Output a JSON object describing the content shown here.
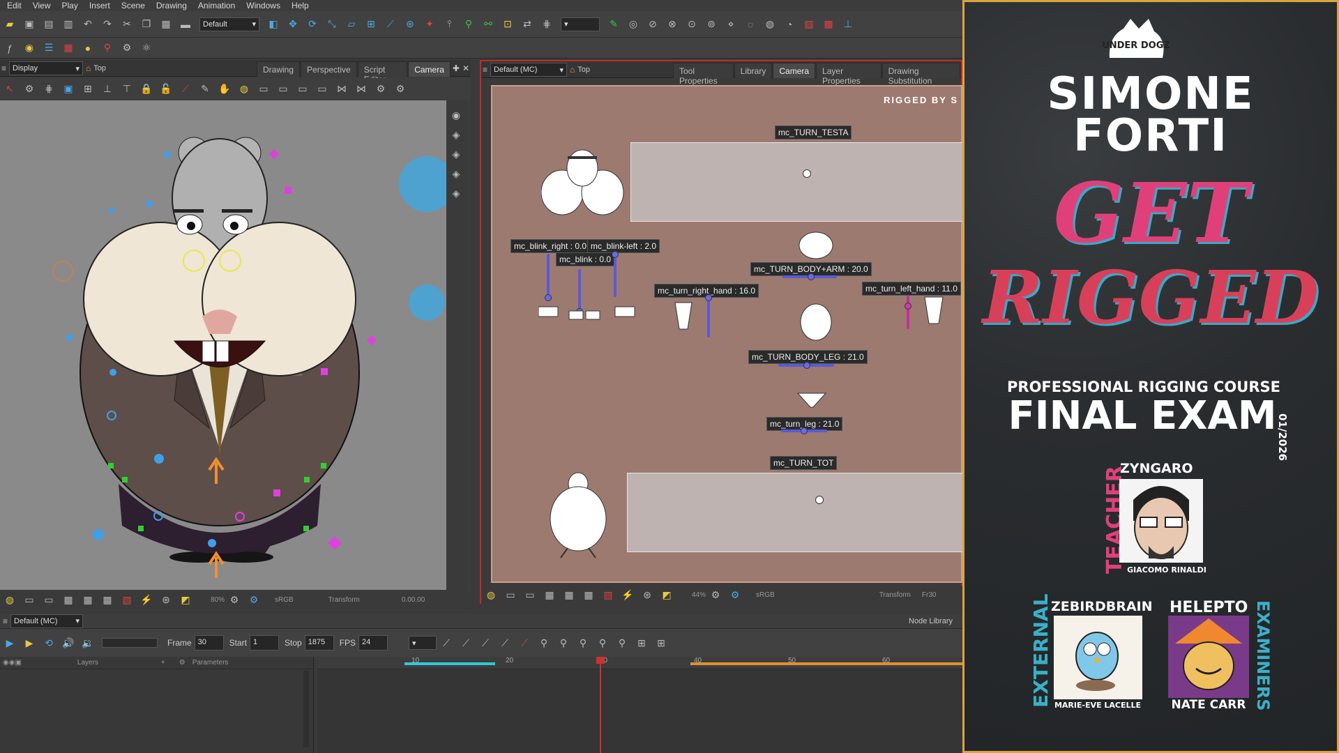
{
  "menu": [
    "Edit",
    "View",
    "Play",
    "Insert",
    "Scene",
    "Drawing",
    "Animation",
    "Windows",
    "Help"
  ],
  "toolbar": {
    "preset": "Default"
  },
  "left_view": {
    "display_dropdown": "Display",
    "top_label": "Top",
    "tabs": [
      "Drawing",
      "Perspective",
      "Script Editor",
      "Camera"
    ],
    "zoom": "80%",
    "color_space": "sRGB",
    "mode": "Transform",
    "timecode": "0.00.00"
  },
  "right_view": {
    "dropdown": "Default (MC)",
    "top_label": "Top",
    "tabs": [
      "Tool Properties",
      "Library",
      "Camera",
      "Layer Properties",
      "Drawing Substitution"
    ],
    "rigged_by": "RIGGED BY S",
    "controls": {
      "turn_testa": "mc_TURN_TESTA",
      "blink_right": "mc_blink_right : 0.0",
      "blink_left": "mc_blink-left : 2.0",
      "blink": "mc_blink : 0.0",
      "turn_body_arm": "mc_TURN_BODY+ARM : 20.0",
      "turn_right_hand": "mc_turn_right_hand : 16.0",
      "turn_left_hand": "mc_turn_left_hand : 11.0",
      "turn_body_leg": "mc_TURN_BODY_LEG : 21.0",
      "turn_leg": "mc_turn_leg : 21.0",
      "turn_tot": "mc_TURN_TOT"
    },
    "zoom": "44%",
    "color_space": "sRGB",
    "mode": "Transform",
    "frame": "Fr30"
  },
  "timeline": {
    "dropdown": "Default (MC)",
    "node_library": "Node Library",
    "frame_label": "Frame",
    "frame": "30",
    "start_label": "Start",
    "start": "1",
    "stop_label": "Stop",
    "stop": "1875",
    "fps_label": "FPS",
    "fps": "24",
    "layers_label": "Layers",
    "parameters_label": "Parameters",
    "ruler_ticks": [
      "10",
      "20",
      "30",
      "40",
      "50",
      "60"
    ]
  },
  "poster": {
    "logo": "UNDER DOGZ",
    "name_line1": "SIMONE",
    "name_line2": "FORTI",
    "headline_line1": "GET",
    "headline_line2": "RIGGED",
    "course": "PROFESSIONAL RIGGING COURSE",
    "exam": "FINAL EXAM",
    "date": "01/2026",
    "teacher_role": "TEACHER",
    "teacher_handle": "ZYNGARO",
    "teacher_name": "GIACOMO RINALDI",
    "external_label": "EXTERNAL",
    "examiners_label": "EXAMINERS",
    "examiner1_handle": "ZEBIRDBRAIN",
    "examiner1_name": "MARIE-EVE LACELLE",
    "examiner2_handle": "HELEPTO",
    "examiner2_name": "NATE CARR"
  }
}
